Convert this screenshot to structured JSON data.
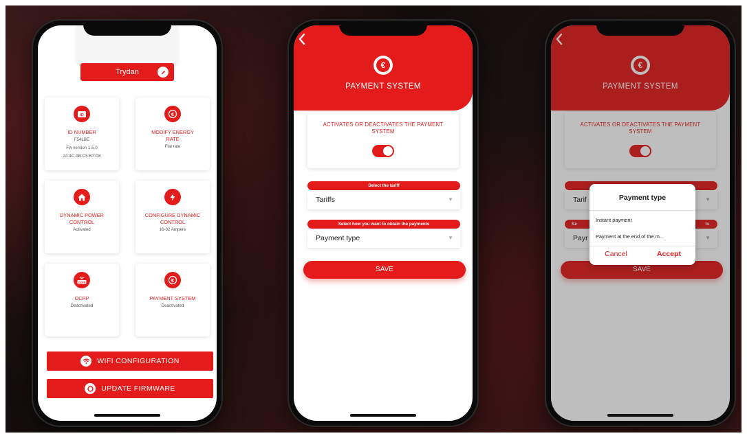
{
  "colors": {
    "accent": "#e41b1b",
    "background": "#1a1414",
    "card": "#ffffff"
  },
  "phone1": {
    "device_name": "Trydan",
    "tiles": [
      {
        "id": "id",
        "icon": "id-card-icon",
        "title": "ID NUMBER",
        "lines": [
          "F54LBE",
          "Fw version 1.5.0",
          "24:4C:AB:C5:B7:D8"
        ]
      },
      {
        "id": "energy",
        "icon": "euro-icon",
        "title": "MODIFY ENERGY RATE",
        "lines": [
          "Flat rate"
        ]
      },
      {
        "id": "dpc",
        "icon": "home-icon",
        "title": "DYNAMIC POWER CONTROL",
        "lines": [
          "Activated"
        ]
      },
      {
        "id": "cdc",
        "icon": "bolt-icon",
        "title": "CONFIGURE DYNAMIC CONTROL",
        "lines": [
          "16-32 Ampere"
        ]
      },
      {
        "id": "ocpp",
        "icon": "ocpp-icon",
        "icon_text": "OCPP",
        "title": "OCPP",
        "lines": [
          "Deactivated"
        ]
      },
      {
        "id": "pay",
        "icon": "euro-icon",
        "title": "PAYMENT SYSTEM",
        "lines": [
          "Deactivated"
        ]
      }
    ],
    "wifi_button": "WIFI CONFIGURATION",
    "firmware_button": "UPDATE FIRMWARE"
  },
  "payment": {
    "back_icon": "chevron-left-icon",
    "title": "PAYMENT SYSTEM",
    "activate_text": "ACTIVATES OR DEACTIVATES THE PAYMENT SYSTEM",
    "toggle_on": true,
    "tariff_label": "Select the tariff",
    "tariff_value": "Tariffs",
    "payments_label": "Select how you want to obtain the payments",
    "payment_value": "Payment type",
    "save": "SAVE"
  },
  "phone3": {
    "tariff_partial": "Tarif",
    "label_partial_left": "Se",
    "label_partial_right": "ts",
    "payment_partial": "Payr",
    "dialog": {
      "title": "Payment type",
      "options": [
        "Instant payment",
        "Payment at the end of the m..."
      ],
      "cancel": "Cancel",
      "accept": "Accept"
    }
  }
}
